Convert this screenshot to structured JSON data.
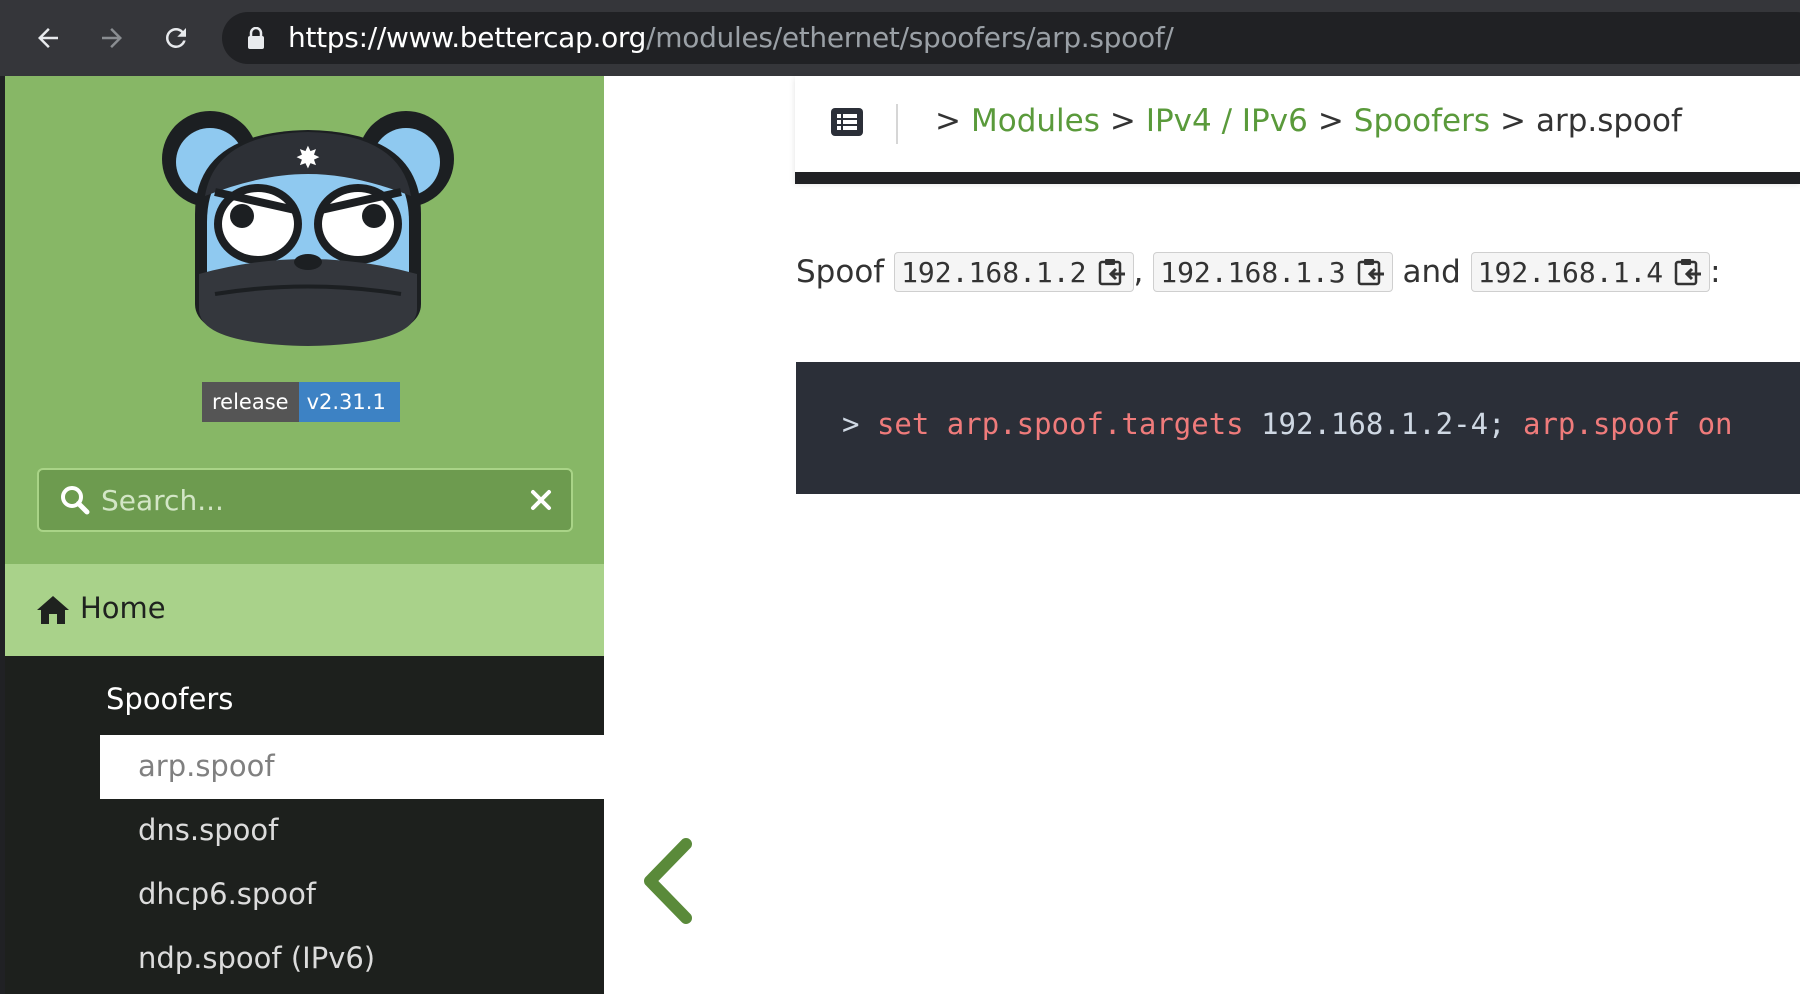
{
  "browser": {
    "url_host": "https://www.bettercap.org",
    "url_path": "/modules/ethernet/spoofers/arp.spoof/",
    "icons": [
      "back-icon",
      "forward-icon",
      "reload-icon",
      "lock-icon"
    ]
  },
  "sidebar": {
    "release_label": "release",
    "release_version": "v2.31.1",
    "search_placeholder": "Search...",
    "home_label": "Home",
    "section_label": "Spoofers",
    "items": [
      {
        "label": "arp.spoof",
        "active": true
      },
      {
        "label": "dns.spoof",
        "active": false
      },
      {
        "label": "dhcp6.spoof",
        "active": false
      },
      {
        "label": "ndp.spoof (IPv6)",
        "active": false
      }
    ],
    "colors": {
      "header_green": "#87b766",
      "home_green": "#a9d28a",
      "dark": "#1d201d"
    }
  },
  "breadcrumb": {
    "items": [
      "Modules",
      "IPv4 / IPv6",
      "Spoofers"
    ],
    "current": "arp.spoof",
    "separator": ">"
  },
  "content": {
    "intro_word": "Spoof",
    "ips": [
      "192.168.1.2",
      "192.168.1.3",
      "192.168.1.4"
    ],
    "comma": ",",
    "and_word": "and",
    "colon": ":",
    "code": {
      "prompt": ">",
      "cmd1": "set",
      "arg1": "arp.spoof.targets",
      "value": "192.168.1.2-4;",
      "cmd2": "arp.spoof",
      "arg2": "on"
    }
  }
}
